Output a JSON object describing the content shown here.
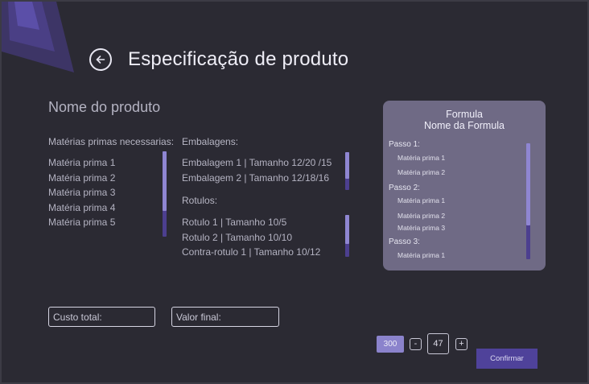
{
  "colors": {
    "background": "#2b2a33",
    "accent": "#4f429a",
    "accent_light": "#8f86d2",
    "card": "#6f6a85"
  },
  "header": {
    "back_icon": "arrow-left-icon",
    "title": "Especificação de produto"
  },
  "product": {
    "name_placeholder": "Nome do produto"
  },
  "raw_materials": {
    "label": "Matérias primas necessarias:",
    "items": [
      "Matéria prima 1",
      "Matéria prima 2",
      "Matéria prima 3",
      "Matéria prima 4",
      "Matéria prima 5"
    ]
  },
  "packaging": {
    "label": "Embalagens:",
    "items": [
      "Embalagem 1 | Tamanho 12/20 /15",
      "Embalagem 2  | Tamanho 12/18/16"
    ]
  },
  "labels_section": {
    "label": "Rotulos:",
    "items": [
      "Rotulo 1 | Tamanho 10/5",
      "Rotulo 2 | Tamanho 10/10",
      "Contra-rotulo 1 | Tamanho 10/12"
    ]
  },
  "formula": {
    "title_line1": "Formula",
    "title_line2": "Nome da Formula",
    "steps": [
      {
        "label": "Passo 1:",
        "items": [
          "Matéria prima 1",
          "Matéria prima 2"
        ]
      },
      {
        "label": "Passo 2:",
        "items": [
          "Matéria prima 1",
          "Matéria prima 2",
          "Matéria prima 3"
        ]
      },
      {
        "label": "Passo 3:",
        "items": [
          "Matéria prima 1"
        ]
      }
    ]
  },
  "totals": {
    "cost_label": "Custo total:",
    "final_label": "Valor final:"
  },
  "quantity": {
    "badge": "300",
    "minus": "-",
    "value": "47",
    "plus": "+"
  },
  "actions": {
    "confirm": "Confirmar"
  }
}
